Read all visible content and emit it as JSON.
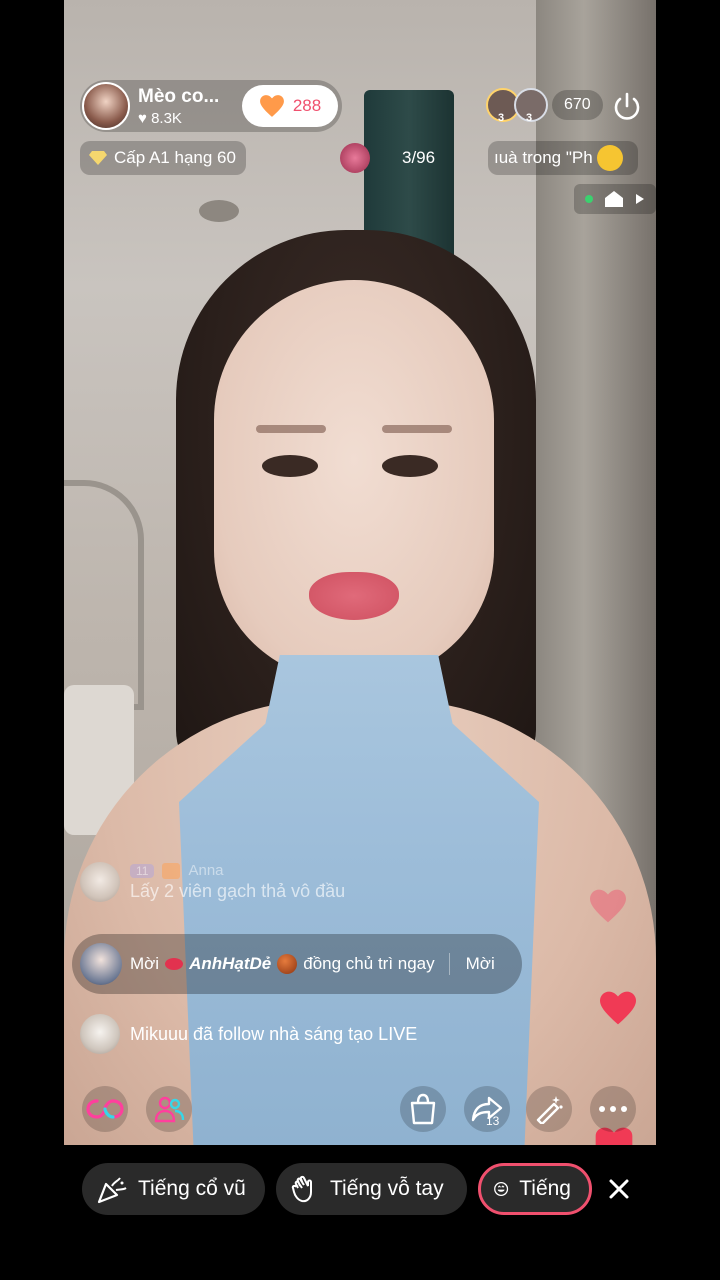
{
  "host": {
    "name": "Mèo co...",
    "likes": "8.3K",
    "follow_count": "288"
  },
  "viewers": {
    "avatar_badges": [
      "3",
      "3"
    ],
    "count": "670"
  },
  "rank_chip": "Cấp A1 hạng 60",
  "gift_progress": "3/96",
  "ticker_text": "ıuà trong \"Ph",
  "chat": [
    {
      "level": "11",
      "user": "Anna",
      "message": "Lấy 2 viên gạch thả vô đầu"
    }
  ],
  "invite": {
    "prefix": "Mời",
    "user": "AnhHạtDẻ",
    "message": "đồng chủ trì ngay",
    "action": "Mời"
  },
  "follow_notice": {
    "user": "Mikuuu",
    "message": "đã follow nhà sáng tạo LIVE"
  },
  "toolbar": {
    "share_count": "13"
  },
  "sound_effects": [
    {
      "label": "Tiếng cổ vũ",
      "icon": "party-popper-icon"
    },
    {
      "label": "Tiếng vỗ tay",
      "icon": "clap-icon"
    },
    {
      "label": "Tiếng",
      "icon": "smile-icon",
      "selected": true
    }
  ],
  "colors": {
    "accent": "#f0506e",
    "follow_heart": "#ff9a4a",
    "live_dot": "#3bd16f"
  }
}
